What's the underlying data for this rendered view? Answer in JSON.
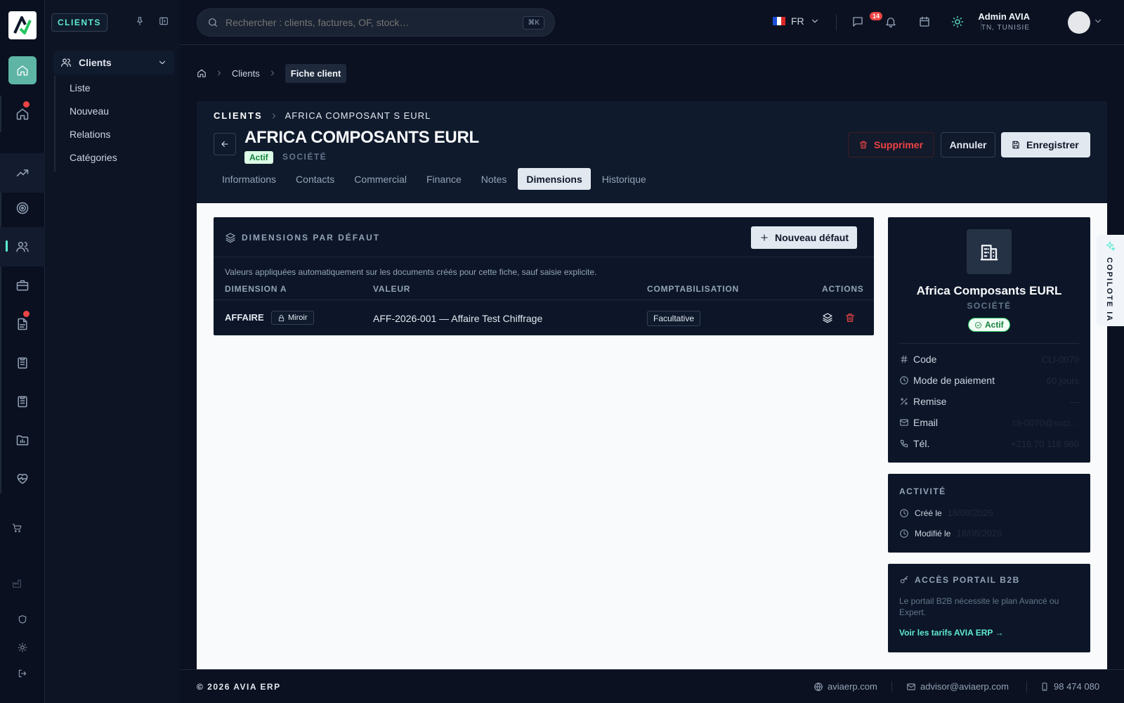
{
  "app": {
    "module_badge": "CLIENTS"
  },
  "sidebar": {
    "group_label": "Clients",
    "items": [
      {
        "label": "Liste"
      },
      {
        "label": "Nouveau"
      },
      {
        "label": "Relations"
      },
      {
        "label": "Catégories"
      }
    ]
  },
  "topbar": {
    "search_placeholder": "Rechercher : clients, factures, OF, stock…",
    "search_shortcut": "⌘K",
    "language": "FR",
    "notifications_count": "14",
    "user_name": "Admin AVIA",
    "user_country": "TN, TUNISIE"
  },
  "breadcrumb": {
    "items": [
      "Clients"
    ],
    "current": "Fiche client"
  },
  "header": {
    "section": "CLIENTS",
    "entity_path": "AFRICA COMPOSANT S EURL",
    "title": "AFRICA COMPOSANTS EURL",
    "status": "Actif",
    "type": "SOCIÉTÉ",
    "actions": {
      "delete": "Supprimer",
      "cancel": "Annuler",
      "save": "Enregistrer"
    },
    "tabs": [
      {
        "label": "Informations",
        "active": false
      },
      {
        "label": "Contacts",
        "active": false
      },
      {
        "label": "Commercial",
        "active": false
      },
      {
        "label": "Finance",
        "active": false
      },
      {
        "label": "Notes",
        "active": false
      },
      {
        "label": "Dimensions",
        "active": true
      },
      {
        "label": "Historique",
        "active": false
      }
    ]
  },
  "dimensions": {
    "title": "DIMENSIONS PAR DÉFAUT",
    "new_button": "Nouveau défaut",
    "description": "Valeurs appliquées automatiquement sur les documents créés pour cette fiche, sauf saisie explicite.",
    "columns": [
      "DIMENSION A",
      "VALEUR",
      "COMPTABILISATION",
      "ACTIONS"
    ],
    "rows": [
      {
        "dimension": "AFFAIRE",
        "dimension_tag": "Miroir",
        "value": "AFF-2026-001 — Affaire Test Chiffrage",
        "accounting": "Facultative"
      }
    ]
  },
  "client_card": {
    "name": "Africa Composants EURL",
    "type": "SOCIÉTÉ",
    "status": "Actif",
    "fields": [
      {
        "label": "Code",
        "value": "CLI-0070",
        "icon": "hash-icon"
      },
      {
        "label": "Mode de paiement",
        "value": "60 jours",
        "icon": "clock-icon"
      },
      {
        "label": "Remise",
        "value": "—",
        "icon": "percent-icon"
      },
      {
        "label": "Email",
        "value": "cli-0070@soci…",
        "icon": "mail-icon"
      },
      {
        "label": "Tél.",
        "value": "+216 70 118 960",
        "icon": "phone-icon"
      }
    ]
  },
  "activity": {
    "title": "ACTIVITÉ",
    "created_label": "Créé le",
    "created_value": "18/08/2026",
    "modified_label": "Modifié le",
    "modified_value": "18/08/2026"
  },
  "b2b": {
    "title": "ACCÈS PORTAIL B2B",
    "description": "Le portail B2B nécessite le plan Avancé ou Expert.",
    "link": "Voir les tarifs AVIA ERP →"
  },
  "copilot": {
    "label": "COPILOTE IA"
  },
  "footer": {
    "copyright": "© 2026  AVIA ERP",
    "website": "aviaerp.com",
    "email": "advisor@aviaerp.com",
    "phone": "98 474 080"
  },
  "colors": {
    "accent": "#5eead4",
    "danger": "#ef4444",
    "success": "#22c55e"
  }
}
